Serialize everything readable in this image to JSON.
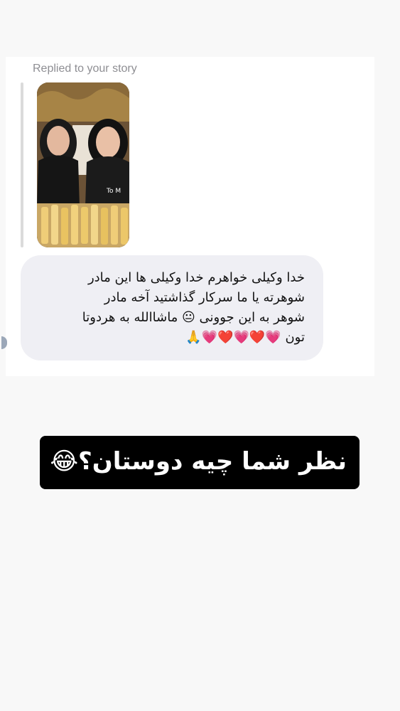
{
  "story_reply": {
    "replied_label": "Replied to your story",
    "thumbnail_icon": "story-thumbnail-photo"
  },
  "message": {
    "text": "خدا وکیلی خواهرم  خدا وکیلی ها این مادر\nشوهرته یا   ما سرکار گذاشتید آخه مادر\nشوهر به این جوونی 😐 ماشاالله به هردوتا\nتون 💗❤️💗❤️💗🙏",
    "bubble_color": "#efeff4"
  },
  "caption": {
    "text": "نظر شما چیه دوستان؟😂",
    "background": "#000000",
    "color": "#ffffff"
  }
}
